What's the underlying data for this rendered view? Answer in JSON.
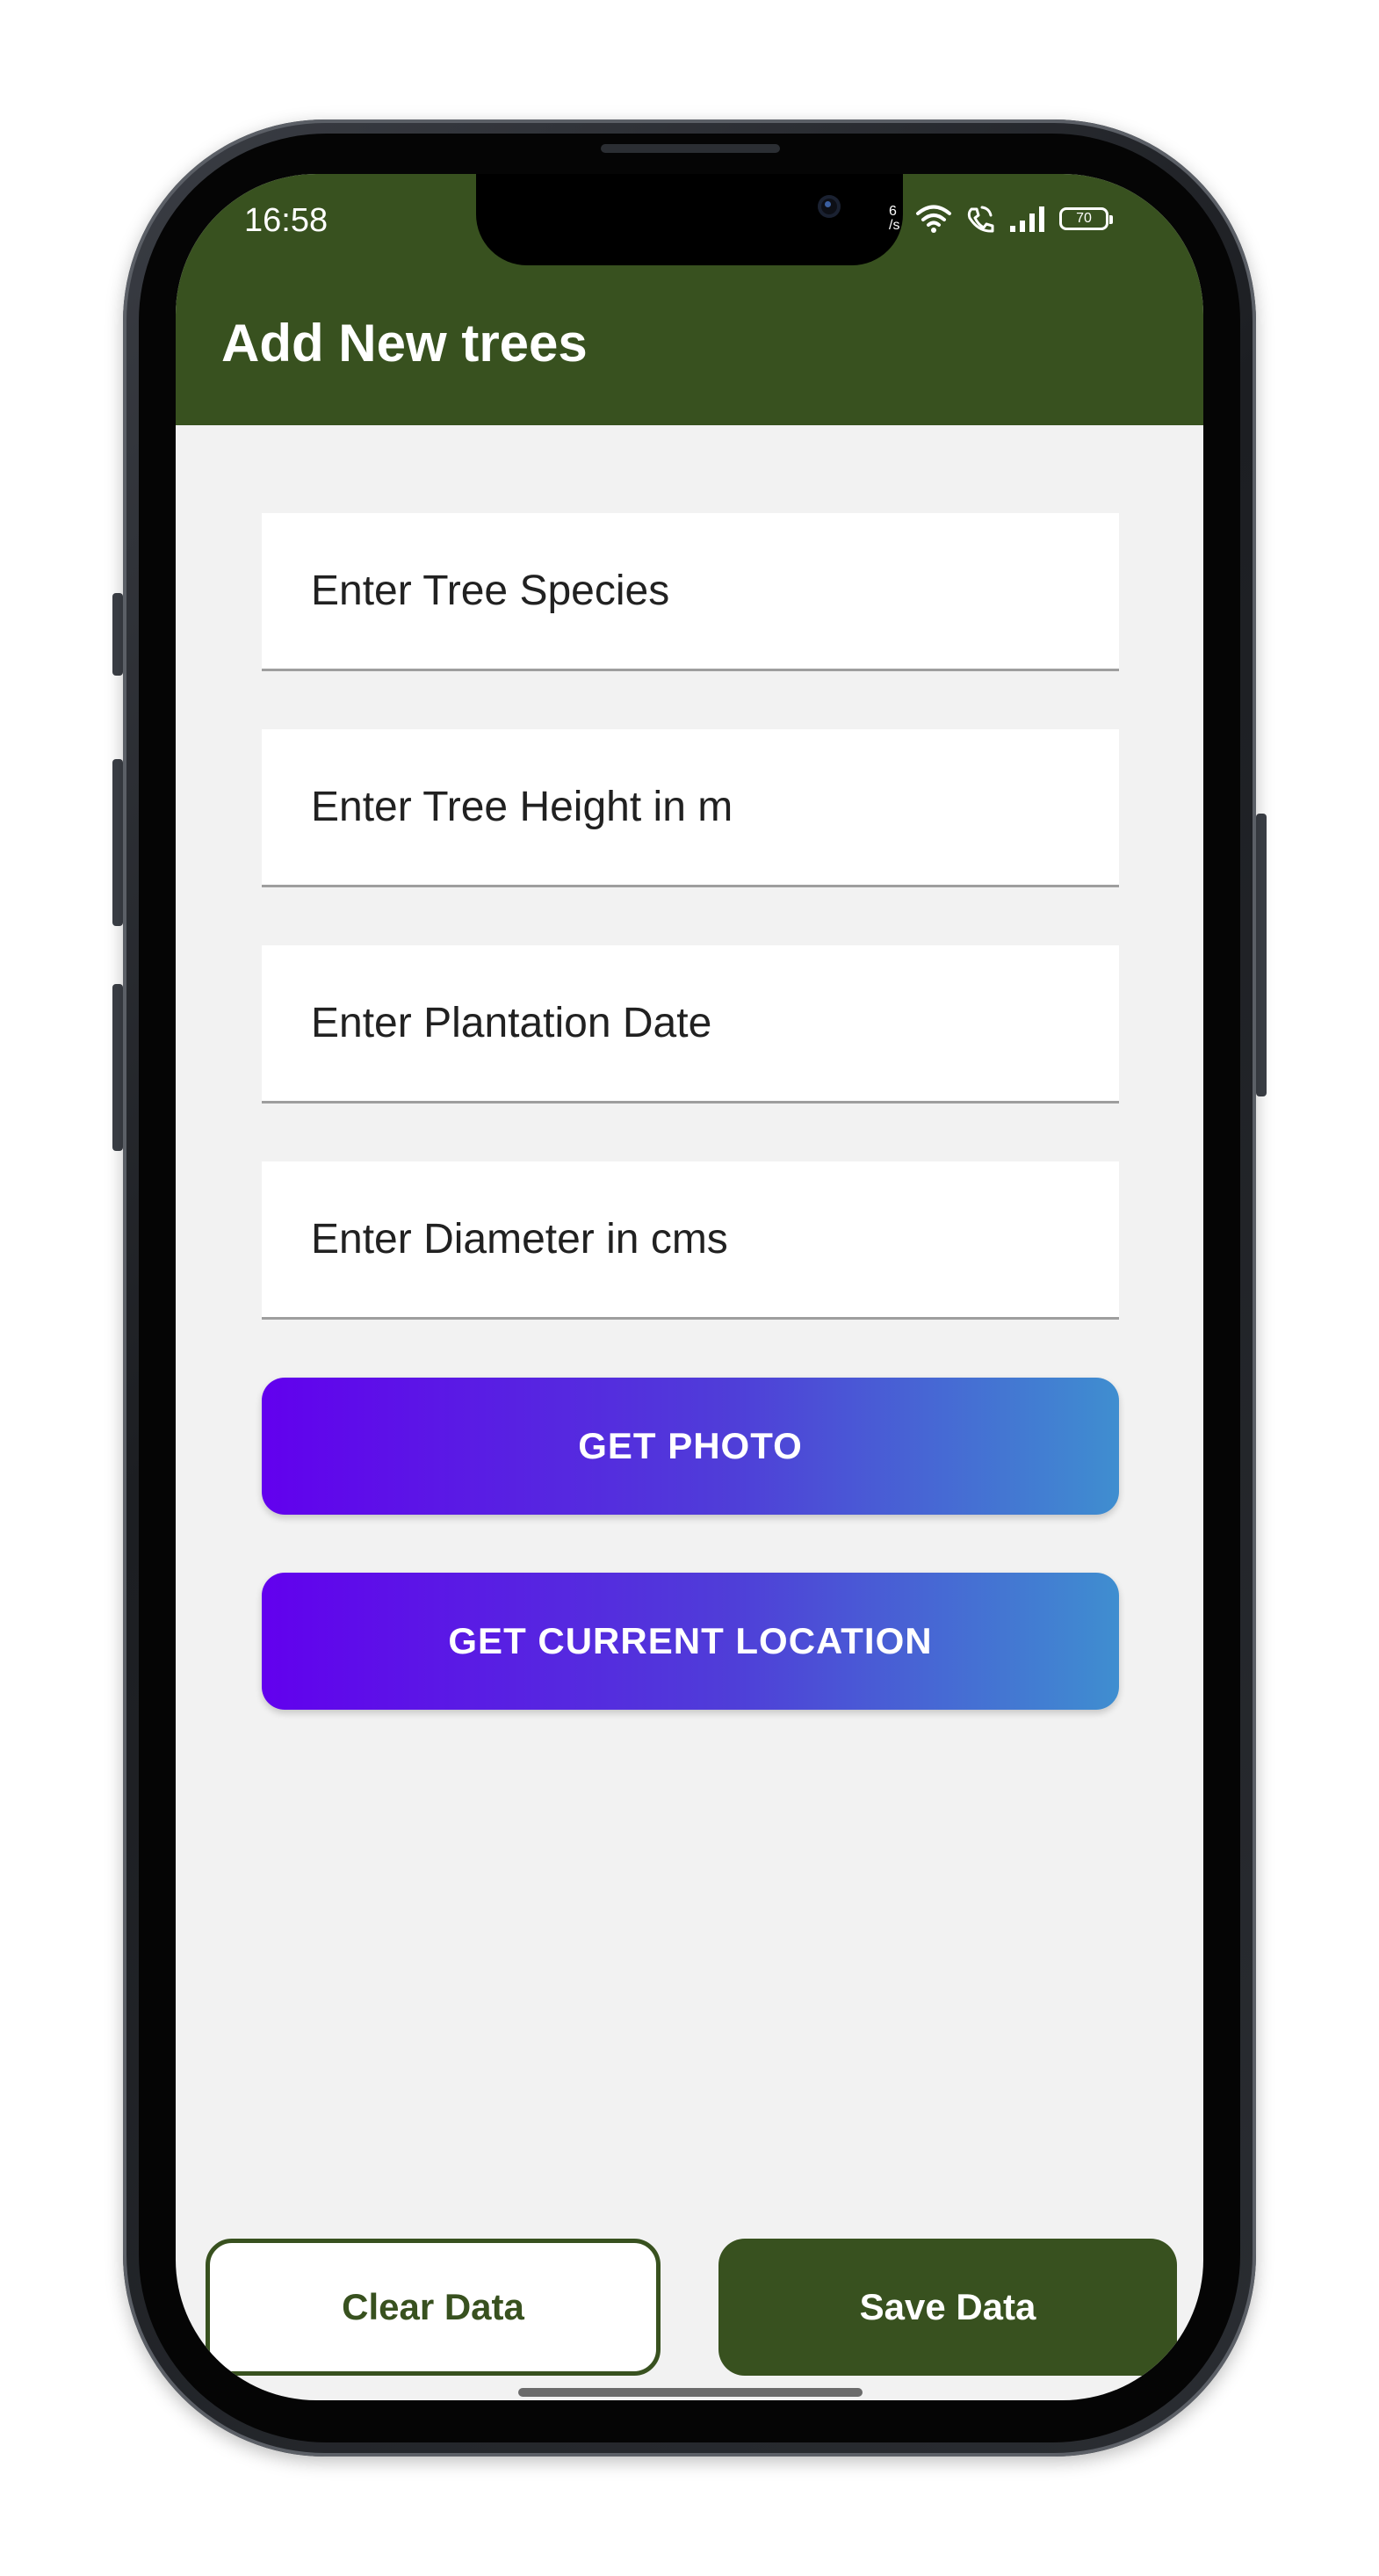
{
  "status_bar": {
    "time": "16:58",
    "net_speed_label": "6 /s",
    "battery": "70",
    "icons": [
      "wifi-icon",
      "volte-call-icon",
      "signal-bars-icon",
      "battery-icon"
    ]
  },
  "header": {
    "title": "Add New trees",
    "background_color": "#38511f"
  },
  "form": {
    "species_placeholder": "Enter Tree Species",
    "height_placeholder": "Enter Tree Height in m",
    "date_placeholder": "Enter Plantation Date",
    "diameter_placeholder": "Enter Diameter in cms",
    "get_photo_label": "GET PHOTO",
    "get_location_label": "GET CURRENT LOCATION"
  },
  "footer": {
    "clear_label": "Clear Data",
    "save_label": "Save Data"
  },
  "colors": {
    "accent_green": "#38511f",
    "gradient_start": "#6200ee",
    "gradient_end": "#3f8ed0",
    "screen_background": "#f2f2f2"
  }
}
